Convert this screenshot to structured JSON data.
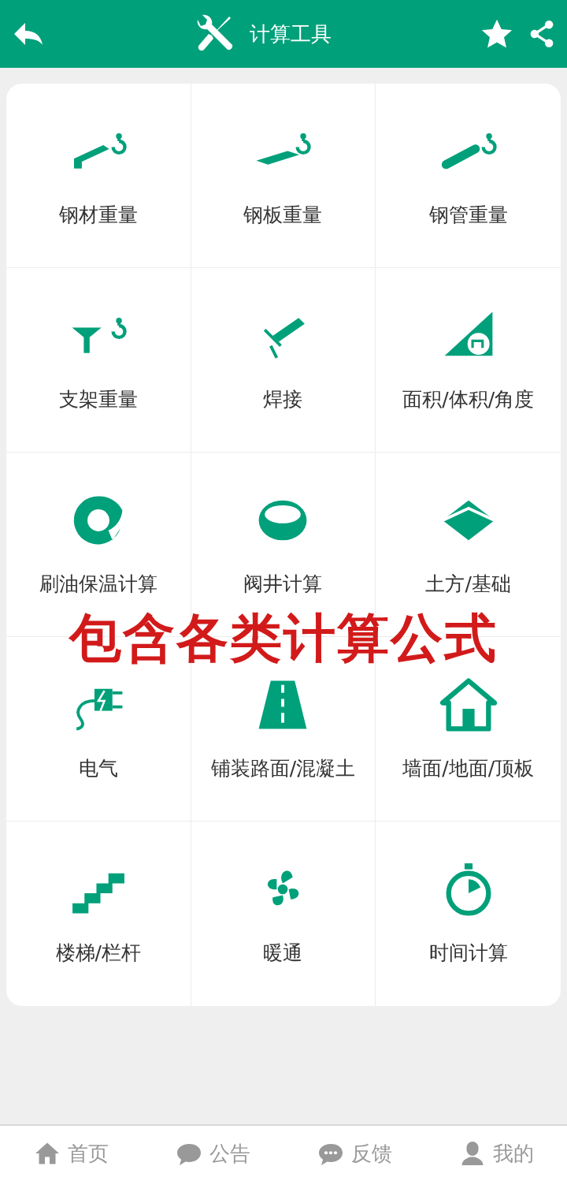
{
  "header": {
    "title": "计算工具"
  },
  "tools": [
    {
      "label": "钢材重量"
    },
    {
      "label": "钢板重量"
    },
    {
      "label": "钢管重量"
    },
    {
      "label": "支架重量"
    },
    {
      "label": "焊接"
    },
    {
      "label": "面积/体积/角度"
    },
    {
      "label": "刷油保温计算"
    },
    {
      "label": "阀井计算"
    },
    {
      "label": "土方/基础"
    },
    {
      "label": "电气"
    },
    {
      "label": "铺装路面/混凝土"
    },
    {
      "label": "墙面/地面/顶板"
    },
    {
      "label": "楼梯/栏杆"
    },
    {
      "label": "暖通"
    },
    {
      "label": "时间计算"
    }
  ],
  "caption": "包含各类计算公式",
  "bottom_nav": [
    {
      "label": "首页"
    },
    {
      "label": "公告"
    },
    {
      "label": "反馈"
    },
    {
      "label": "我的"
    }
  ]
}
